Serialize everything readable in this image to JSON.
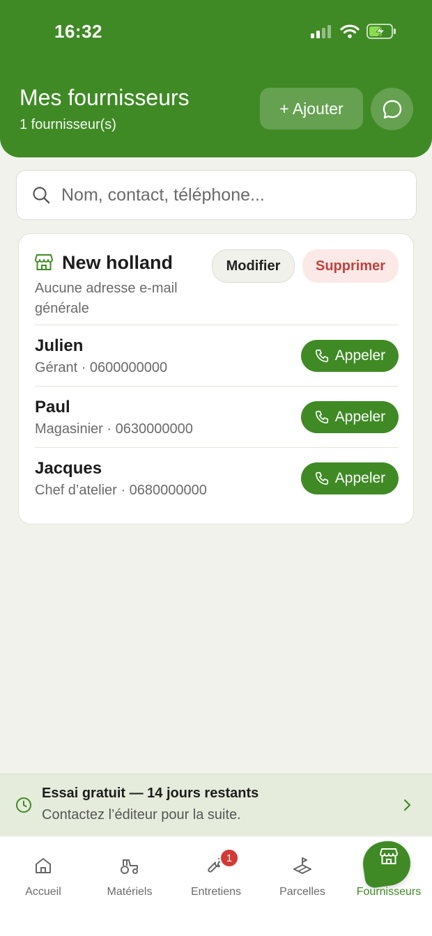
{
  "status_bar": {
    "time": "16:32"
  },
  "header": {
    "title": "Mes fournisseurs",
    "subtitle": "1 fournisseur(s)",
    "add_label": "+ Ajouter"
  },
  "search": {
    "placeholder": "Nom, contact, téléphone..."
  },
  "supplier": {
    "name": "New holland",
    "email": "Aucune adresse e-mail générale",
    "edit_label": "Modifier",
    "delete_label": "Supprimer",
    "contacts": [
      {
        "name": "Julien",
        "meta": "Gérant  · 0600000000",
        "call_label": "Appeler"
      },
      {
        "name": "Paul",
        "meta": "Magasinier  · 0630000000",
        "call_label": "Appeler"
      },
      {
        "name": "Jacques",
        "meta": "Chef d’atelier  · 0680000000",
        "call_label": "Appeler"
      }
    ]
  },
  "trial": {
    "title": "Essai gratuit — 14 jours restants",
    "subtitle": "Contactez l’éditeur pour la suite."
  },
  "tabs": [
    {
      "label": "Accueil",
      "icon": "home-icon"
    },
    {
      "label": "Matériels",
      "icon": "tractor-icon"
    },
    {
      "label": "Entretiens",
      "icon": "wrench-icon",
      "badge": "1"
    },
    {
      "label": "Parcelles",
      "icon": "field-icon"
    },
    {
      "label": "Fournisseurs",
      "icon": "store-icon",
      "active": true
    }
  ],
  "colors": {
    "brand_green": "#3f8a25",
    "danger": "#c0413c",
    "background": "#f2f2ed"
  }
}
